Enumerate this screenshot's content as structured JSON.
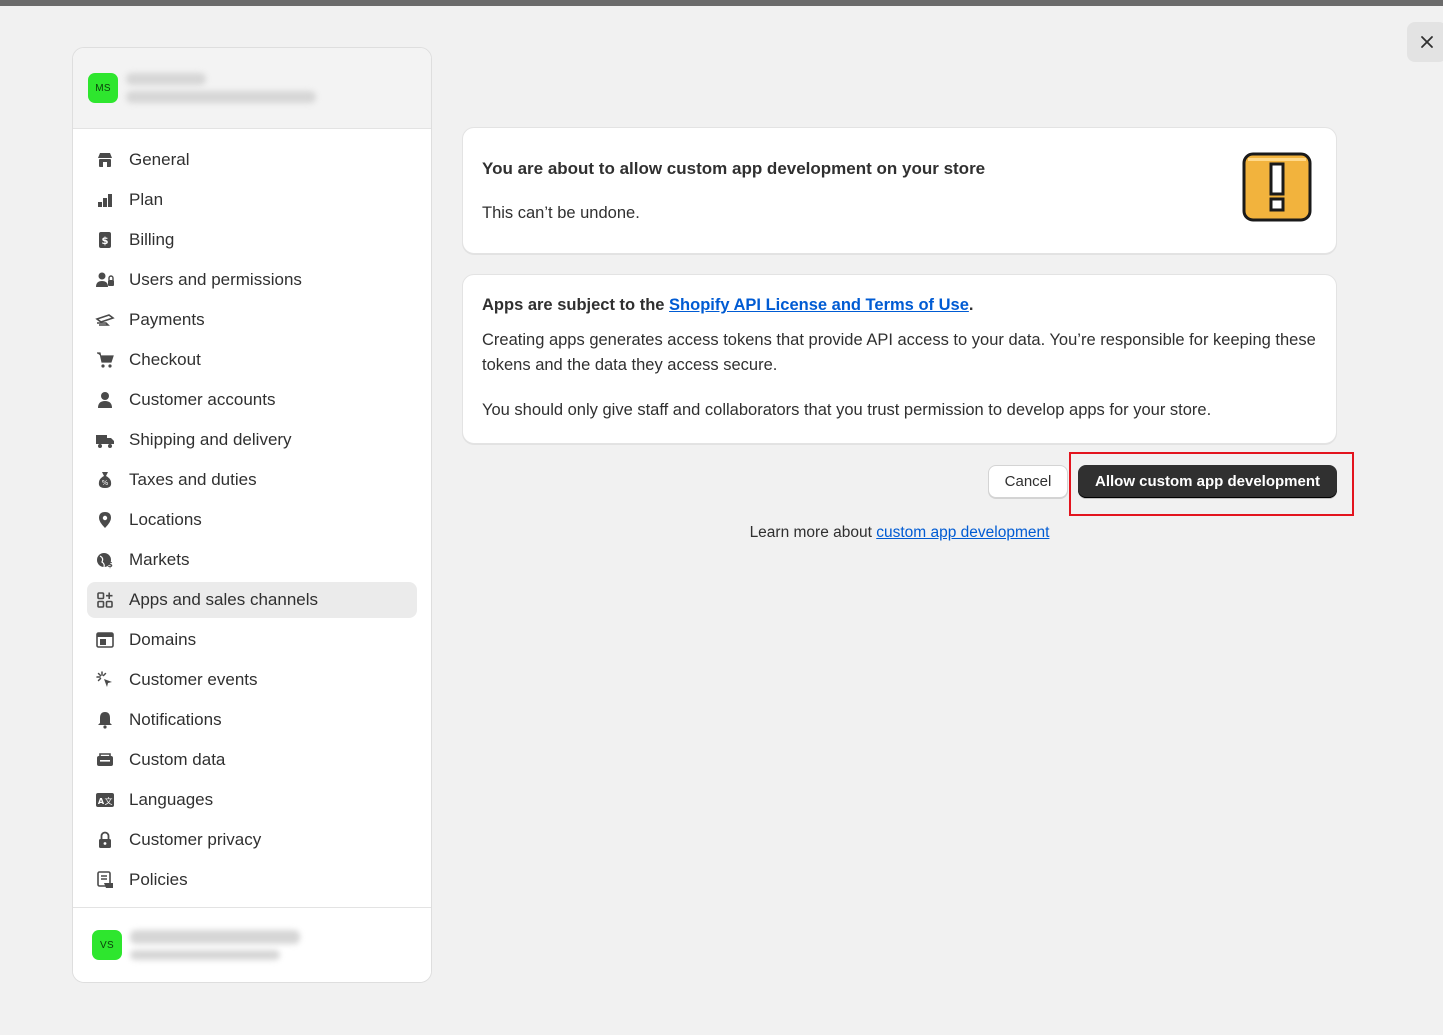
{
  "modal": {
    "close_label": "×"
  },
  "store": {
    "avatar_initials": "MS"
  },
  "sidebar": {
    "items": [
      {
        "label": "General",
        "icon": "store-icon"
      },
      {
        "label": "Plan",
        "icon": "plan-icon"
      },
      {
        "label": "Billing",
        "icon": "billing-icon"
      },
      {
        "label": "Users and permissions",
        "icon": "users-icon"
      },
      {
        "label": "Payments",
        "icon": "payments-icon"
      },
      {
        "label": "Checkout",
        "icon": "cart-icon"
      },
      {
        "label": "Customer accounts",
        "icon": "person-icon"
      },
      {
        "label": "Shipping and delivery",
        "icon": "truck-icon"
      },
      {
        "label": "Taxes and duties",
        "icon": "tax-icon"
      },
      {
        "label": "Locations",
        "icon": "location-icon"
      },
      {
        "label": "Markets",
        "icon": "globe-icon"
      },
      {
        "label": "Apps and sales channels",
        "icon": "apps-icon",
        "active": true
      },
      {
        "label": "Domains",
        "icon": "domains-icon"
      },
      {
        "label": "Customer events",
        "icon": "cursor-icon"
      },
      {
        "label": "Notifications",
        "icon": "bell-icon"
      },
      {
        "label": "Custom data",
        "icon": "database-icon"
      },
      {
        "label": "Languages",
        "icon": "language-icon"
      },
      {
        "label": "Customer privacy",
        "icon": "lock-icon"
      },
      {
        "label": "Policies",
        "icon": "policies-icon"
      }
    ],
    "footer_avatar_initials": "VS"
  },
  "warning_card": {
    "title": "You are about to allow custom app development on your store",
    "subtitle": "This can’t be undone."
  },
  "terms_card": {
    "heading_prefix": "Apps are subject to the ",
    "heading_link": "Shopify API License and Terms of Use",
    "heading_suffix": ".",
    "paragraph1": "Creating apps generates access tokens that provide API access to your data. You’re responsible for keeping these tokens and the data they access secure.",
    "paragraph2": "You should only give staff and collaborators that you trust permission to develop apps for your store."
  },
  "actions": {
    "cancel_label": "Cancel",
    "allow_label": "Allow custom app development"
  },
  "learn_more": {
    "prefix": "Learn more about ",
    "link": "custom app development"
  },
  "colors": {
    "avatar_green": "#2ee62e",
    "primary_button": "#303030",
    "link_blue": "#005bd3",
    "highlight_red": "#e3141e",
    "warning_yellow": "#f2b33d"
  }
}
